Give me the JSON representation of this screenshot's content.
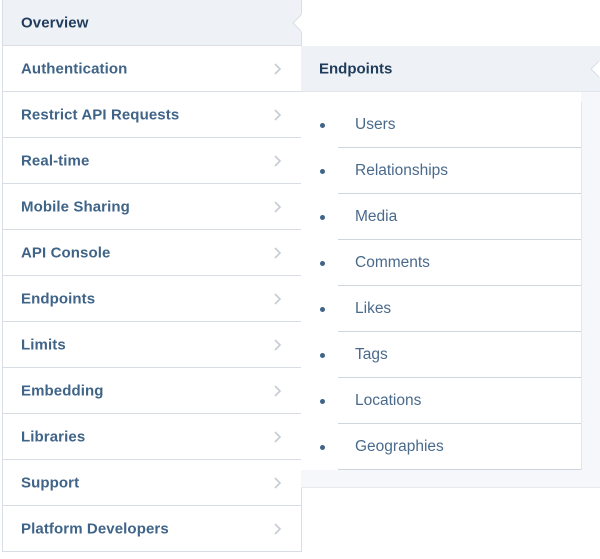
{
  "nav": {
    "items": [
      {
        "label": "Overview",
        "active": true
      },
      {
        "label": "Authentication"
      },
      {
        "label": "Restrict API Requests"
      },
      {
        "label": "Real-time"
      },
      {
        "label": "Mobile Sharing"
      },
      {
        "label": "API Console"
      },
      {
        "label": "Endpoints"
      },
      {
        "label": "Limits"
      },
      {
        "label": "Embedding"
      },
      {
        "label": "Libraries"
      },
      {
        "label": "Support"
      },
      {
        "label": "Platform Developers"
      }
    ]
  },
  "subpanel": {
    "title": "Endpoints",
    "items": [
      {
        "label": "Users"
      },
      {
        "label": "Relationships"
      },
      {
        "label": "Media"
      },
      {
        "label": "Comments"
      },
      {
        "label": "Likes"
      },
      {
        "label": "Tags"
      },
      {
        "label": "Locations"
      },
      {
        "label": "Geographies"
      }
    ]
  },
  "colors": {
    "nav_text": "#3f6488",
    "active_text": "#1f3c5c",
    "active_bg": "#eef1f5",
    "border": "#d9dee6"
  }
}
